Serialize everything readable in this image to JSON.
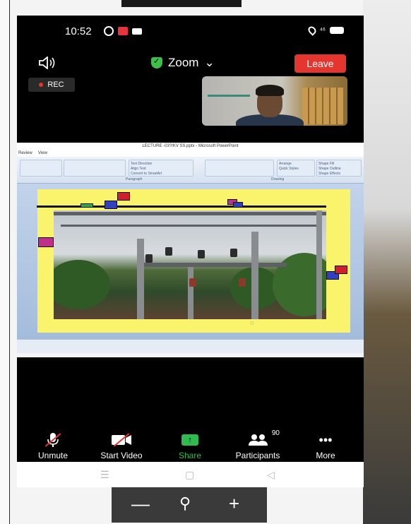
{
  "status": {
    "time": "10:52",
    "signal": "⁴⁶"
  },
  "meeting": {
    "title": "Zoom",
    "leave_label": "Leave",
    "rec_label": "REC"
  },
  "presentation": {
    "window_title": "LECTURE -03?/KV SS.pptx - Microsoft PowerPoint",
    "menu_items": [
      "Review",
      "View"
    ],
    "ribbon_groups": [
      "Paragraph",
      "Drawing"
    ],
    "ribbon_items": [
      "Text Direction",
      "Align Text",
      "Convert to SmartArt",
      "Arrange",
      "Quick Styles",
      "Shape Fill",
      "Shape Outline",
      "Shape Effects"
    ]
  },
  "controls": {
    "unmute": "Unmute",
    "start_video": "Start Video",
    "share": "Share",
    "participants": "Participants",
    "participants_count": "90",
    "more": "More"
  },
  "colors": {
    "leave": "#e5352f",
    "share": "#2fbb4f",
    "slide": "#faf36c"
  },
  "icons": [
    "whatsapp-icon",
    "screen-record-icon",
    "video-icon",
    "location-icon",
    "battery-icon",
    "speaker-icon",
    "shield-icon",
    "chevron-down-icon",
    "mic-muted-icon",
    "video-off-icon",
    "share-arrow-icon",
    "participants-icon",
    "more-dots-icon",
    "menu-lines-icon",
    "home-square-icon",
    "back-triangle-icon",
    "zoom-out-icon",
    "magnify-icon",
    "zoom-in-icon"
  ]
}
